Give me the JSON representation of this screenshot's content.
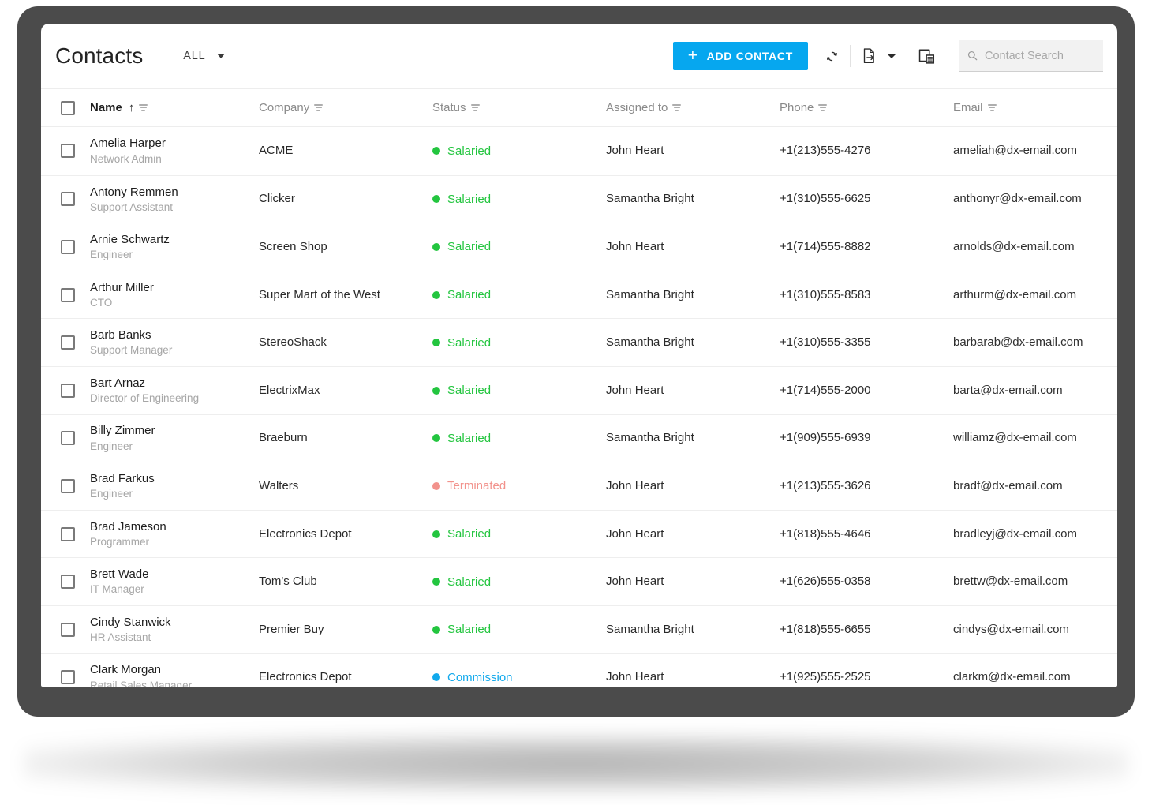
{
  "header": {
    "title": "Contacts",
    "scope_filter": "ALL",
    "add_contact_label": "ADD CONTACT",
    "add_contact_plus": "+",
    "refresh_icon": "refresh-icon",
    "export_icon": "export-icon",
    "export_caret_icon": "chevron-down-icon",
    "column_chooser_icon": "column-chooser-icon",
    "search_icon": "search-icon",
    "search_placeholder": "Contact Search",
    "search_value": ""
  },
  "colors": {
    "accent": "#06a7ef",
    "status_salaried": "#23c53f",
    "status_terminated": "#f2928c",
    "status_commission": "#11a9ec",
    "frame": "#4b4b4b",
    "card": "#ffffff"
  },
  "grid": {
    "sort_column": "Name",
    "sort_direction": "asc",
    "sort_arrow_glyph": "↑",
    "columns": [
      {
        "key": "name",
        "label": "Name"
      },
      {
        "key": "company",
        "label": "Company"
      },
      {
        "key": "status",
        "label": "Status"
      },
      {
        "key": "assigned",
        "label": "Assigned to"
      },
      {
        "key": "phone",
        "label": "Phone"
      },
      {
        "key": "email",
        "label": "Email"
      }
    ],
    "select_all_checked": false,
    "rows": [
      {
        "name": "Amelia Harper",
        "position": "Network Admin",
        "company": "ACME",
        "status": "Salaried",
        "status_color": "#23c53f",
        "assigned": "John Heart",
        "phone": "+1(213)555-4276",
        "email": "ameliah@dx-email.com",
        "checked": false
      },
      {
        "name": "Antony Remmen",
        "position": "Support Assistant",
        "company": "Clicker",
        "status": "Salaried",
        "status_color": "#23c53f",
        "assigned": "Samantha Bright",
        "phone": "+1(310)555-6625",
        "email": "anthonyr@dx-email.com",
        "checked": false
      },
      {
        "name": "Arnie Schwartz",
        "position": "Engineer",
        "company": "Screen Shop",
        "status": "Salaried",
        "status_color": "#23c53f",
        "assigned": "John Heart",
        "phone": "+1(714)555-8882",
        "email": "arnolds@dx-email.com",
        "checked": false
      },
      {
        "name": "Arthur Miller",
        "position": "CTO",
        "company": "Super Mart of the West",
        "status": "Salaried",
        "status_color": "#23c53f",
        "assigned": "Samantha Bright",
        "phone": "+1(310)555-8583",
        "email": "arthurm@dx-email.com",
        "checked": false
      },
      {
        "name": "Barb Banks",
        "position": "Support Manager",
        "company": "StereoShack",
        "status": "Salaried",
        "status_color": "#23c53f",
        "assigned": "Samantha Bright",
        "phone": "+1(310)555-3355",
        "email": "barbarab@dx-email.com",
        "checked": false
      },
      {
        "name": "Bart Arnaz",
        "position": "Director of Engineering",
        "company": "ElectrixMax",
        "status": "Salaried",
        "status_color": "#23c53f",
        "assigned": "John Heart",
        "phone": "+1(714)555-2000",
        "email": "barta@dx-email.com",
        "checked": false
      },
      {
        "name": "Billy Zimmer",
        "position": "Engineer",
        "company": "Braeburn",
        "status": "Salaried",
        "status_color": "#23c53f",
        "assigned": "Samantha Bright",
        "phone": "+1(909)555-6939",
        "email": "williamz@dx-email.com",
        "checked": false
      },
      {
        "name": "Brad Farkus",
        "position": "Engineer",
        "company": "Walters",
        "status": "Terminated",
        "status_color": "#f2928c",
        "assigned": "John Heart",
        "phone": "+1(213)555-3626",
        "email": "bradf@dx-email.com",
        "checked": false
      },
      {
        "name": "Brad Jameson",
        "position": "Programmer",
        "company": "Electronics Depot",
        "status": "Salaried",
        "status_color": "#23c53f",
        "assigned": "John Heart",
        "phone": "+1(818)555-4646",
        "email": "bradleyj@dx-email.com",
        "checked": false
      },
      {
        "name": "Brett Wade",
        "position": "IT Manager",
        "company": "Tom's Club",
        "status": "Salaried",
        "status_color": "#23c53f",
        "assigned": "John Heart",
        "phone": "+1(626)555-0358",
        "email": "brettw@dx-email.com",
        "checked": false
      },
      {
        "name": "Cindy Stanwick",
        "position": "HR Assistant",
        "company": "Premier Buy",
        "status": "Salaried",
        "status_color": "#23c53f",
        "assigned": "Samantha Bright",
        "phone": "+1(818)555-6655",
        "email": "cindys@dx-email.com",
        "checked": false
      },
      {
        "name": "Clark Morgan",
        "position": "Retail Sales Manager",
        "company": "Electronics Depot",
        "status": "Commission",
        "status_color": "#11a9ec",
        "assigned": "John Heart",
        "phone": "+1(925)555-2525",
        "email": "clarkm@dx-email.com",
        "checked": false
      }
    ]
  }
}
